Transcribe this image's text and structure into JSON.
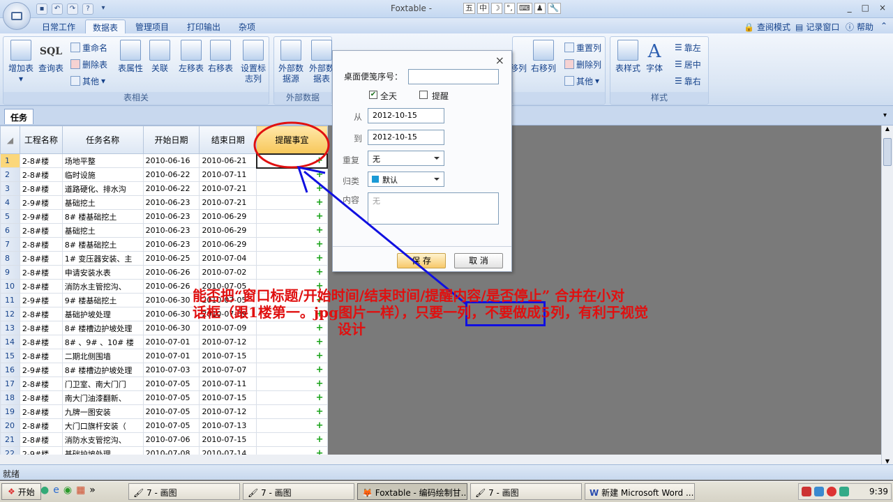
{
  "window": {
    "title": "Foxtable -",
    "controls": [
      "_",
      "□",
      "×"
    ]
  },
  "ime": {
    "items": [
      "中",
      "☽",
      "°,",
      "⌨",
      "♟",
      "🔧"
    ]
  },
  "ribbon_tabs": [
    "日常工作",
    "数据表",
    "管理项目",
    "打印输出",
    "杂项"
  ],
  "ribbon_right": {
    "readmode": "查阅模式",
    "recordwin": "记录窗口",
    "help": "帮助"
  },
  "groups": {
    "table": {
      "label": "表相关",
      "add": "增加表",
      "query": "查询表",
      "rename": "重命名",
      "delete": "删除表",
      "other": "其他",
      "props": "表属性",
      "relation": "关联",
      "moveleft": "左移表",
      "moveright": "右移表",
      "setflag": "设置标志列",
      "sql": "SQL"
    },
    "external": {
      "label": "外部数据",
      "source": "外部数据源",
      "data": "外部数据表"
    },
    "col": {
      "movecol": "移列",
      "rightcol": "右移列",
      "resetcol": "重置列",
      "delcol": "删除列",
      "othercol": "其他"
    },
    "style": {
      "label": "样式",
      "tablestyle": "表样式",
      "font": "字体",
      "left": "靠左",
      "center": "居中",
      "right": "靠右"
    }
  },
  "doc_tab": "任务",
  "grid": {
    "headers": [
      "工程名称",
      "任务名称",
      "开始日期",
      "结束日期",
      "提醒事宜"
    ],
    "rows": [
      [
        "1",
        "2-8#楼",
        "场地平整",
        "2010-06-16",
        "2010-06-21"
      ],
      [
        "2",
        "2-8#楼",
        "临时设施",
        "2010-06-22",
        "2010-07-11"
      ],
      [
        "3",
        "2-8#楼",
        "道路硬化、排水沟",
        "2010-06-22",
        "2010-07-21"
      ],
      [
        "4",
        "2-9#楼",
        "基础挖土",
        "2010-06-23",
        "2010-07-21"
      ],
      [
        "5",
        "2-9#楼",
        "8# 楼基础挖土",
        "2010-06-23",
        "2010-06-29"
      ],
      [
        "6",
        "2-8#楼",
        "基础挖土",
        "2010-06-23",
        "2010-06-29"
      ],
      [
        "7",
        "2-8#楼",
        "8# 楼基础挖土",
        "2010-06-23",
        "2010-06-29"
      ],
      [
        "8",
        "2-8#楼",
        "1# 变压器安装、主",
        "2010-06-25",
        "2010-07-04"
      ],
      [
        "9",
        "2-8#楼",
        "申请安装水表",
        "2010-06-26",
        "2010-07-02"
      ],
      [
        "10",
        "2-8#楼",
        "消防水主管挖沟、",
        "2010-06-26",
        "2010-07-05"
      ],
      [
        "11",
        "2-9#楼",
        "9# 楼基础挖土",
        "2010-06-30",
        "2010-07-05"
      ],
      [
        "12",
        "2-8#楼",
        "基础护坡处理",
        "2010-06-30",
        "2010-07-09"
      ],
      [
        "13",
        "2-8#楼",
        "8# 楼槽边护坡处理",
        "2010-06-30",
        "2010-07-09"
      ],
      [
        "14",
        "2-8#楼",
        "8# 、9# 、10# 楼",
        "2010-07-01",
        "2010-07-12"
      ],
      [
        "15",
        "2-8#楼",
        "二期北侧围墙",
        "2010-07-01",
        "2010-07-15"
      ],
      [
        "16",
        "2-9#楼",
        "8# 楼槽边护坡处理",
        "2010-07-03",
        "2010-07-07"
      ],
      [
        "17",
        "2-8#楼",
        "门卫室、南大门门",
        "2010-07-05",
        "2010-07-11"
      ],
      [
        "18",
        "2-8#楼",
        "南大门油漆翻新、",
        "2010-07-05",
        "2010-07-15"
      ],
      [
        "19",
        "2-8#楼",
        "九牌一图安装",
        "2010-07-05",
        "2010-07-12"
      ],
      [
        "20",
        "2-8#楼",
        "大门口旗杆安装（",
        "2010-07-05",
        "2010-07-13"
      ],
      [
        "21",
        "2-8#楼",
        "消防水支管挖沟、",
        "2010-07-06",
        "2010-07-15"
      ],
      [
        "22",
        "2-9#楼",
        "基础护坡处理",
        "2010-07-08",
        "2010-07-14"
      ]
    ]
  },
  "popup": {
    "desk_label": "桌面便笺序号：",
    "allday": "全天",
    "remind": "提醒",
    "from_label": "从",
    "from": "2012-10-15",
    "to_label": "到",
    "to": "2012-10-15",
    "repeat_label": "重复",
    "repeat": "无",
    "cat_label": "归类",
    "cat": "默认",
    "content_label": "内容",
    "content": "无",
    "save": "保 存",
    "cancel": "取 消"
  },
  "annotation": {
    "line1": "能否把“窗口标题/开始时间/结束时间/提醒内容/是否停止” 合并在小对",
    "line2": "话框（跟1楼第一。jpg图片一样），只要一列，不要做成5列，有利于视觉",
    "line3": "设计"
  },
  "status": "就绪",
  "taskbar": {
    "start": "开始",
    "tasks": [
      "7 - 画图",
      "7 - 画图",
      "Foxtable - 编码绘制甘...",
      "7 - 画图",
      "新建 Microsoft Word ..."
    ],
    "time": "9:39"
  },
  "colors": {
    "accent": "#15428b",
    "annotation": "#e01010",
    "highlight": "#fbd77b"
  }
}
